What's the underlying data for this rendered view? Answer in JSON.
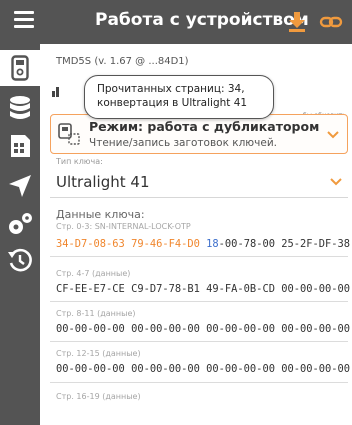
{
  "appbar": {
    "title": "Работа с устройством",
    "colors": {
      "bar": "#545454",
      "accent": "#f09a3e"
    },
    "icons": [
      "menu-icon",
      "download-icon",
      "link-icon"
    ]
  },
  "rail": {
    "items": [
      {
        "name": "device-icon",
        "active": true
      },
      {
        "name": "database-icon",
        "active": false
      },
      {
        "name": "sim-card-icon",
        "active": false
      },
      {
        "name": "navigation-icon",
        "active": false
      },
      {
        "name": "settings-icon",
        "active": false
      },
      {
        "name": "history-icon",
        "active": false
      }
    ]
  },
  "device": {
    "line": "TMD5S (v. 1.67 @ ...84D1)",
    "refresh_hint": "бы обновить"
  },
  "tooltip": {
    "line1": "Прочитанных страниц: 34,",
    "line2": "конвертация в Ultralight 41"
  },
  "mode": {
    "title": "Режим: работа с дубликатором",
    "subtitle": "Чтение/запись заготовок ключей."
  },
  "key_type": {
    "label": "Тип ключа:",
    "value": "Ultralight 41"
  },
  "key_data": {
    "label": "Данные ключа:",
    "pages": [
      {
        "label": "Стр. 0-3: SN-INTERNAL-LOCK-OTP",
        "segments": [
          {
            "text": "34-D7-08-63 ",
            "class": "seg-orange"
          },
          {
            "text": "79-46-F4-D0 ",
            "class": "seg-orange"
          },
          {
            "text": "18",
            "class": "seg-blue"
          },
          {
            "text": "-00-78-00 25-2F-DF-38",
            "class": "seg-dark"
          }
        ]
      },
      {
        "label": "Стр. 4-7 (данные)",
        "segments": [
          {
            "text": "CF-EE-E7-CE C9-D7-78-B1 49-FA-0B-CD 00-00-00-00",
            "class": "seg-dark"
          }
        ]
      },
      {
        "label": "Стр. 8-11 (данные)",
        "segments": [
          {
            "text": "00-00-00-00 00-00-00-00 00-00-00-00 00-00-00-00",
            "class": "seg-dark"
          }
        ]
      },
      {
        "label": "Стр. 12-15 (данные)",
        "segments": [
          {
            "text": "00-00-00-00 00-00-00-00 00-00-00-00 00-00-00-00",
            "class": "seg-dark"
          }
        ]
      },
      {
        "label": "Стр. 16-19 (данные)",
        "segments": []
      }
    ]
  }
}
